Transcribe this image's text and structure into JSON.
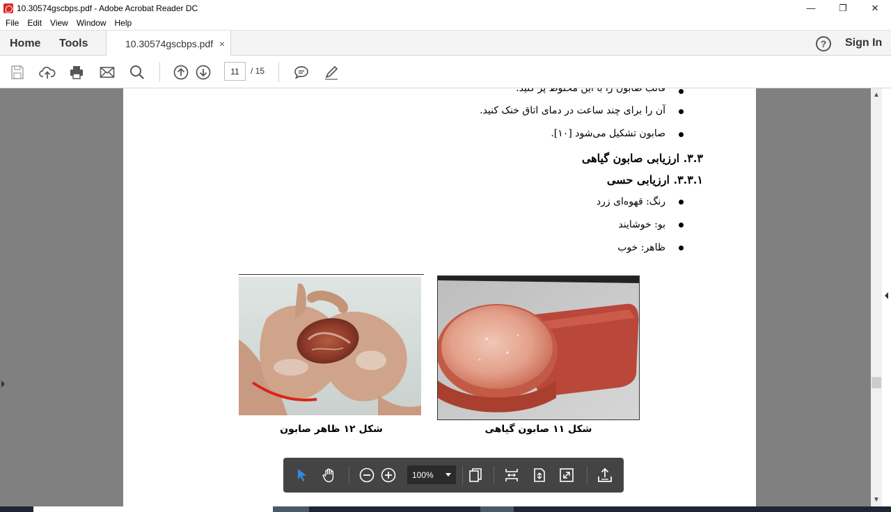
{
  "window": {
    "title": "10.30574gscbps.pdf - Adobe Acrobat Reader DC"
  },
  "menu": [
    "File",
    "Edit",
    "View",
    "Window",
    "Help"
  ],
  "tabs": {
    "home": "Home",
    "tools": "Tools",
    "document": "10.30574gscbps.pdf",
    "close": "×"
  },
  "header": {
    "help": "?",
    "sign_in": "Sign In"
  },
  "toolbar": {
    "page_current": "11",
    "page_total": "/ 15"
  },
  "content": {
    "line_top": "قالب صابون را با این مخلوط پر کنید.",
    "line1": "آن را برای چند ساعت در دمای اتاق خنک کنید.",
    "line2": "صابون تشکیل می‌شود [۱۰].",
    "heading1": "۳.۳. ارزیابی صابون گیاهی",
    "heading2": "۳.۳.۱. ارزیابی حسی",
    "item_color": "رنگ: قهوه‌ای زرد",
    "item_smell": "بو: خوشایند",
    "item_look": "ظاهر: خوب",
    "caption_left": "شکل ۱۲ ظاهر صابون",
    "caption_right": "شکل ۱۱ صابون گیاهی"
  },
  "floatbar": {
    "zoom": "100%"
  },
  "colors": {
    "viewer_bg": "#808080",
    "floatbar_bg": "#444444",
    "accent": "#2d8ce0"
  }
}
